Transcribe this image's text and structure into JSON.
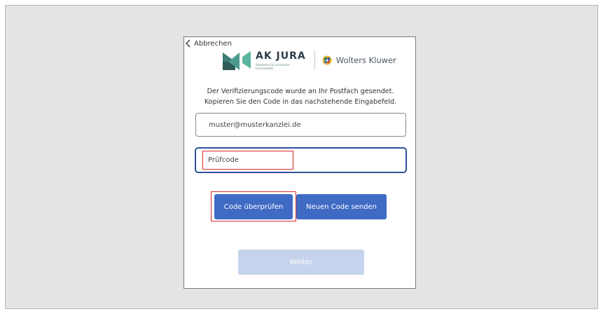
{
  "dialog": {
    "back_label": "Abbrechen",
    "logo": {
      "akjura_title": "AK JURA",
      "akjura_subtitle": "Akademie für Juristische Fachanwälte",
      "wk_name": "Wolters Kluwer",
      "icons": [
        "akjura-logo-mark",
        "wolters-kluwer-globe"
      ]
    },
    "info_line1": "Der Verifizierungscode wurde an Ihr Postfach gesendet.",
    "info_line2": "Kopieren Sie den Code in das nachstehende Eingabefeld.",
    "email_value": "muster@musterkanzlei.de",
    "code_placeholder": "Prüfcode",
    "verify_button": "Code überprüfen",
    "resend_button": "Neuen Code senden",
    "next_button": "Weiter"
  },
  "colors": {
    "primary_button": "#3f6bc4",
    "disabled_button": "#c5d4ec",
    "focus_border": "#2f4f9a",
    "highlight_red": "#d42a2a",
    "backdrop": "#e4e4e4"
  }
}
